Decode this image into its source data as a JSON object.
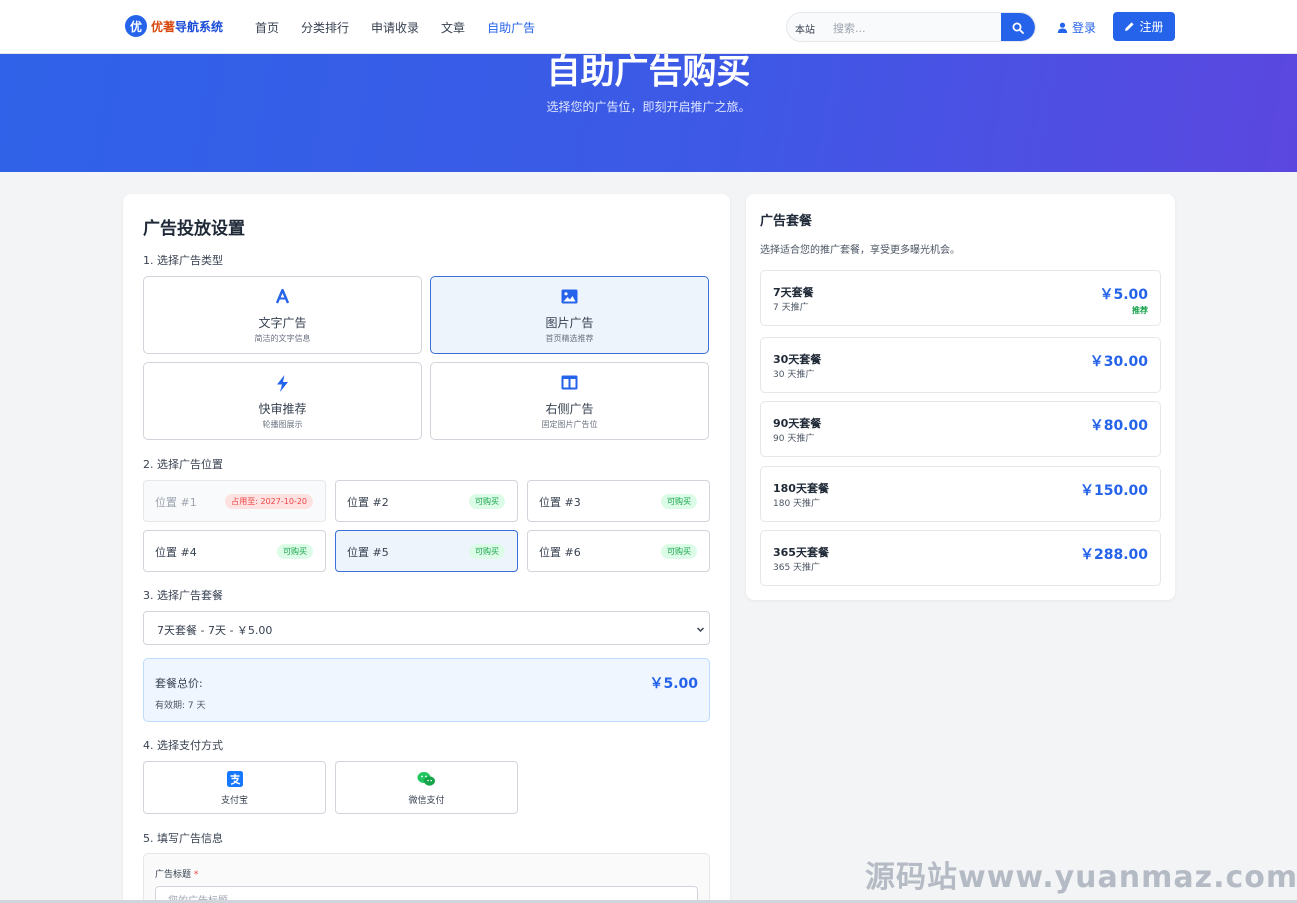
{
  "nav": {
    "logo_badge": "优",
    "logo_text_a": "优著",
    "logo_text_b": "导航系统",
    "links": [
      {
        "label": "首页",
        "active": false
      },
      {
        "label": "分类排行",
        "active": false
      },
      {
        "label": "申请收录",
        "active": false
      },
      {
        "label": "文章",
        "active": false
      },
      {
        "label": "自助广告",
        "active": true
      }
    ],
    "search_scope": "本站",
    "search_placeholder": "搜索...",
    "login_label": "登录",
    "register_label": "注册"
  },
  "hero": {
    "title": "自助广告购买",
    "subtitle": "选择您的广告位，即刻开启推广之旅。"
  },
  "form": {
    "title": "广告投放设置",
    "step1": "1. 选择广告类型",
    "ad_types": [
      {
        "title": "文字广告",
        "desc": "简洁的文字信息",
        "icon": "font-icon",
        "selected": false
      },
      {
        "title": "图片广告",
        "desc": "首页精选推荐",
        "icon": "image-icon",
        "selected": true
      },
      {
        "title": "快审推荐",
        "desc": "轮播图展示",
        "icon": "bolt-icon",
        "selected": false
      },
      {
        "title": "右侧广告",
        "desc": "固定图片广告位",
        "icon": "columns-icon",
        "selected": false
      }
    ],
    "step2": "2. 选择广告位置",
    "positions": [
      {
        "label": "位置 #1",
        "status": "占用至: 2027-10-20",
        "occupied": true,
        "selected": false
      },
      {
        "label": "位置 #2",
        "status": "可购买",
        "occupied": false,
        "selected": false
      },
      {
        "label": "位置 #3",
        "status": "可购买",
        "occupied": false,
        "selected": false
      },
      {
        "label": "位置 #4",
        "status": "可购买",
        "occupied": false,
        "selected": false
      },
      {
        "label": "位置 #5",
        "status": "可购买",
        "occupied": false,
        "selected": true
      },
      {
        "label": "位置 #6",
        "status": "可购买",
        "occupied": false,
        "selected": false
      }
    ],
    "step3": "3. 选择广告套餐",
    "package_select_value": "7天套餐 - 7天 - ￥5.00",
    "total_label": "套餐总价:",
    "total_duration": "有效期: 7 天",
    "total_price": "￥5.00",
    "step4": "4. 选择支付方式",
    "payments": [
      {
        "label": "支付宝",
        "icon": "alipay-icon"
      },
      {
        "label": "微信支付",
        "icon": "wechat-icon"
      }
    ],
    "step5": "5. 填写广告信息",
    "ad_title_label": "广告标题",
    "ad_title_required": "*",
    "ad_title_placeholder": "您的广告标题"
  },
  "packages": {
    "title": "广告套餐",
    "desc": "选择适合您的推广套餐，享受更多曝光机会。",
    "items": [
      {
        "name": "7天套餐",
        "sub": "7 天推广",
        "price": "￥5.00",
        "tag": "推荐"
      },
      {
        "name": "30天套餐",
        "sub": "30 天推广",
        "price": "￥30.00",
        "tag": ""
      },
      {
        "name": "90天套餐",
        "sub": "90 天推广",
        "price": "￥80.00",
        "tag": ""
      },
      {
        "name": "180天套餐",
        "sub": "180 天推广",
        "price": "￥150.00",
        "tag": ""
      },
      {
        "name": "365天套餐",
        "sub": "365 天推广",
        "price": "￥288.00",
        "tag": ""
      }
    ]
  },
  "watermark": "源码站www.yuanmaz.com",
  "colors": {
    "accent": "#2563eb",
    "available": "#16a34a",
    "occupied": "#ef4444"
  }
}
